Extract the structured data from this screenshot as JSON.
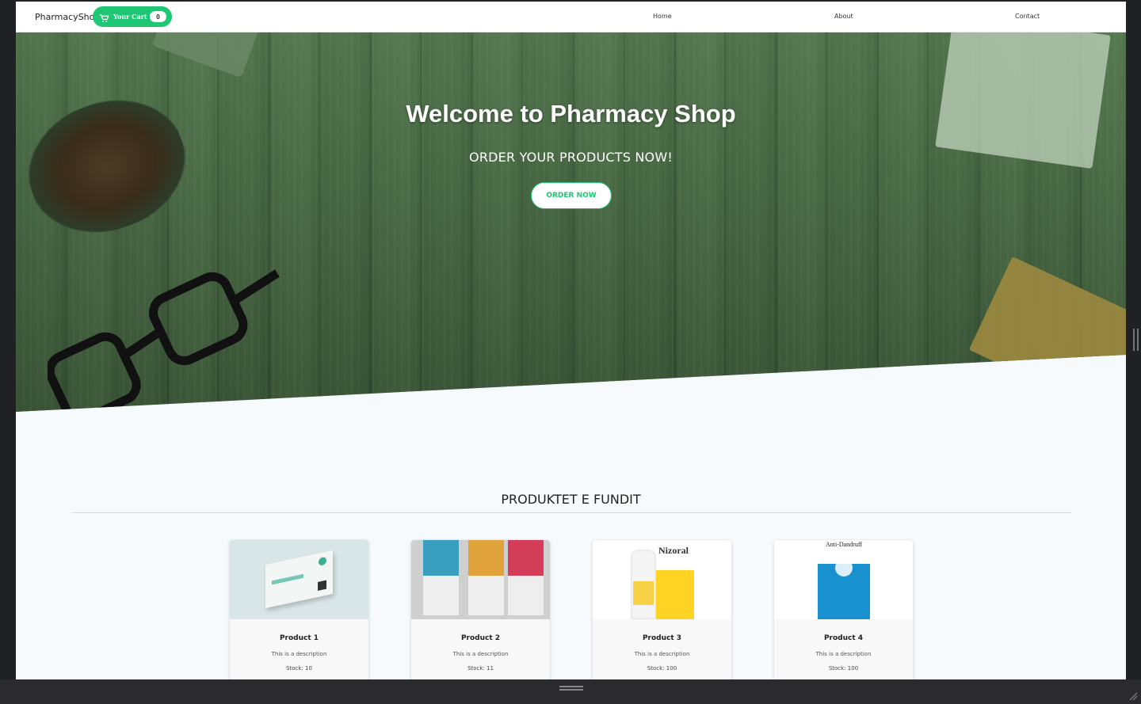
{
  "nav": {
    "brand": "PharmacyShop",
    "cart_label": "Your Cart",
    "cart_count": "0",
    "links": [
      "Home",
      "About",
      "Contact"
    ]
  },
  "hero": {
    "title": "Welcome to Pharmacy Shop",
    "subtitle": "ORDER YOUR PRODUCTS NOW!",
    "button": "ORDER NOW"
  },
  "section": {
    "title": "PRODUKTET E FUNDIT"
  },
  "products": [
    {
      "name": "Product 1",
      "description": "This is a description",
      "stock": "Stock: 10"
    },
    {
      "name": "Product 2",
      "description": "This is a description",
      "stock": "Stock: 11"
    },
    {
      "name": "Product 3",
      "description": "This is a description",
      "stock": "Stock: 100",
      "image_text": "Nizoral"
    },
    {
      "name": "Product 4",
      "description": "This is a description",
      "stock": "Stock: 100",
      "image_text": "Anti-Dandruff"
    }
  ],
  "colors": {
    "accent": "#1ec773",
    "page_bg": "#f7fafd",
    "frame_bg": "#202124"
  }
}
